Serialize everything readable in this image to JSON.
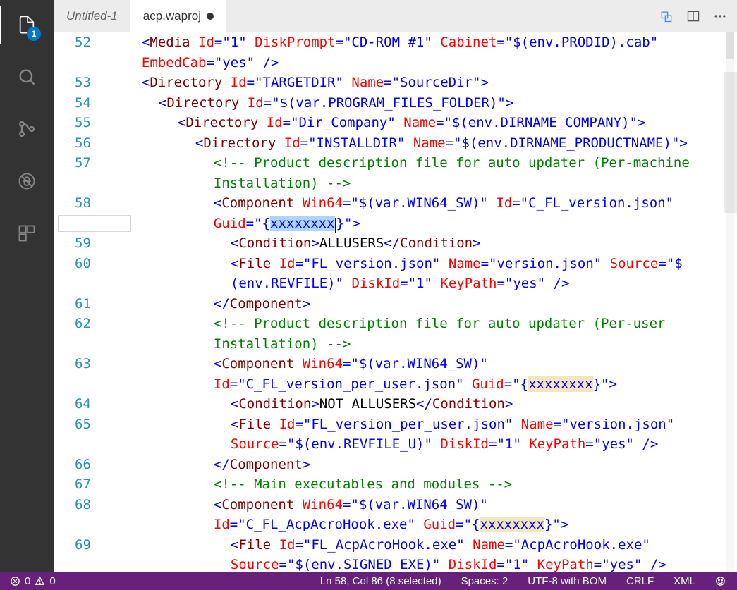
{
  "activityBar": {
    "explorerBadge": "1"
  },
  "tabs": {
    "tab0Label": "Untitled-1",
    "tab1Label": "acp.waproj"
  },
  "status": {
    "errors": "0",
    "warnings": "0",
    "cursorPos": "Ln 58, Col 86 (8 selected)",
    "indentation": "Spaces: 2",
    "encoding": "UTF-8 with BOM",
    "eol": "CRLF",
    "language": "XML"
  },
  "gutter": {
    "l52": "52",
    "l53": "53",
    "l54": "54",
    "l55": "55",
    "l56": "56",
    "l57": "57",
    "l58": "58",
    "l59": "59",
    "l60": "60",
    "l61": "61",
    "l62": "62",
    "l63": "63",
    "l64": "64",
    "l65": "65",
    "l66": "66",
    "l67": "67",
    "l68": "68",
    "l69": "69"
  },
  "code": {
    "l52": {
      "ob": "<",
      "tag": "Media",
      "sp": " ",
      "a1": "Id",
      "eq": "=",
      "v1": "\"1\"",
      "sp2": " ",
      "a2": "DiskPrompt",
      "v2": "\"CD-ROM #1\"",
      "sp3": " ",
      "a3": "Cabinet",
      "v3": "\"$(env.PRODID).cab\""
    },
    "l52b": {
      "a4": "EmbedCab",
      "eq": "=",
      "v4": "\"yes\"",
      "cl": " />"
    },
    "l53": {
      "ob": "<",
      "tag": "Directory",
      "sp": " ",
      "a1": "Id",
      "eq": "=",
      "v1": "\"TARGETDIR\"",
      "sp2": " ",
      "a2": "Name",
      "v2": "\"SourceDir\"",
      "cl": ">"
    },
    "l54": {
      "ob": "<",
      "tag": "Directory",
      "sp": " ",
      "a1": "Id",
      "eq": "=",
      "v1": "\"$(var.PROGRAM_FILES_FOLDER)\"",
      "cl": ">"
    },
    "l55": {
      "ob": "<",
      "tag": "Directory",
      "sp": " ",
      "a1": "Id",
      "eq": "=",
      "v1": "\"Dir_Company\"",
      "sp2": " ",
      "a2": "Name",
      "v2": "\"$(env.DIRNAME_COMPANY)\"",
      "cl": ">"
    },
    "l56": {
      "ob": "<",
      "tag": "Directory",
      "sp": " ",
      "a1": "Id",
      "eq": "=",
      "v1": "\"INSTALLDIR\"",
      "sp2": " ",
      "a2": "Name",
      "v2": "\"$(env.DIRNAME_PRODUCTNAME)\"",
      "cl": ">"
    },
    "l57": {
      "cm1": "<!-- ",
      "cmTxt": "Product description file for auto updater (Per-machine"
    },
    "l57b": {
      "cmTxt": "Installation)",
      "cm2": " -->"
    },
    "l58": {
      "ob": "<",
      "tag": "Component",
      "sp": " ",
      "a1": "Win64",
      "eq": "=",
      "v1": "\"$(var.WIN64_SW)\"",
      "sp2": " ",
      "a2": "Id",
      "v2": "\"C_FL_version.json\""
    },
    "l58b": {
      "a3": "Guid",
      "eq": "=",
      "v3o": "\"{",
      "sel": "xxxxxxxx",
      "v3c": "}\"",
      "cl": ">"
    },
    "l59": {
      "ob": "<",
      "tag": "Condition",
      "cl": ">",
      "txt": "ALLUSERS",
      "co": "</",
      "tag2": "Condition",
      "cc": ">"
    },
    "l60": {
      "ob": "<",
      "tag": "File",
      "sp": " ",
      "a1": "Id",
      "eq": "=",
      "v1": "\"FL_version.json\"",
      "sp2": " ",
      "a2": "Name",
      "v2": "\"version.json\"",
      "sp3": " ",
      "a3": "Source",
      "v3": "\"$"
    },
    "l60b": {
      "v3": "(env.REVFILE)\"",
      "sp": " ",
      "a4": "DiskId",
      "eq": "=",
      "v4": "\"1\"",
      "sp2": " ",
      "a5": "KeyPath",
      "v5": "\"yes\"",
      "cl": " />"
    },
    "l61": {
      "co": "</",
      "tag": "Component",
      "cc": ">"
    },
    "l62": {
      "cm1": "<!-- ",
      "cmTxt": "Product description file for auto updater (Per-user"
    },
    "l62b": {
      "cmTxt": "Installation)",
      "cm2": " -->"
    },
    "l63": {
      "ob": "<",
      "tag": "Component",
      "sp": " ",
      "a1": "Win64",
      "eq": "=",
      "v1": "\"$(var.WIN64_SW)\""
    },
    "l63b": {
      "a2": "Id",
      "eq": "=",
      "v2": "\"C_FL_version_per_user.json\"",
      "sp": " ",
      "a3": "Guid",
      "v3o": "\"{",
      "hl": "xxxxxxxx",
      "v3c": "}\"",
      "cl": ">"
    },
    "l64": {
      "ob": "<",
      "tag": "Condition",
      "cl": ">",
      "txt": "NOT ALLUSERS",
      "co": "</",
      "tag2": "Condition",
      "cc": ">"
    },
    "l65": {
      "ob": "<",
      "tag": "File",
      "sp": " ",
      "a1": "Id",
      "eq": "=",
      "v1": "\"FL_version_per_user.json\"",
      "sp2": " ",
      "a2": "Name",
      "v2": "\"version.json\""
    },
    "l65b": {
      "a3": "Source",
      "eq": "=",
      "v3": "\"$(env.REVFILE_U)\"",
      "sp": " ",
      "a4": "DiskId",
      "v4": "\"1\"",
      "sp2": " ",
      "a5": "KeyPath",
      "v5": "\"yes\"",
      "cl": " />"
    },
    "l66": {
      "co": "</",
      "tag": "Component",
      "cc": ">"
    },
    "l67": {
      "cm1": "<!-- ",
      "cmTxt": "Main executables and modules",
      "cm2": " -->"
    },
    "l68": {
      "ob": "<",
      "tag": "Component",
      "sp": " ",
      "a1": "Win64",
      "eq": "=",
      "v1": "\"$(var.WIN64_SW)\""
    },
    "l68b": {
      "a2": "Id",
      "eq": "=",
      "v2": "\"C_FL_AcpAcroHook.exe\"",
      "sp": " ",
      "a3": "Guid",
      "v3o": "\"{",
      "hl": "xxxxxxxx",
      "v3c": "}\"",
      "cl": ">"
    },
    "l69": {
      "ob": "<",
      "tag": "File",
      "sp": " ",
      "a1": "Id",
      "eq": "=",
      "v1": "\"FL_AcpAcroHook.exe\"",
      "sp2": " ",
      "a2": "Name",
      "v2": "\"AcpAcroHook.exe\""
    },
    "l69b": {
      "a3": "Source",
      "eq": "=",
      "v3": "\"$(env.SIGNED_EXE)\"",
      "sp": " ",
      "a4": "DiskId",
      "v4": "\"1\"",
      "sp2": " ",
      "a5": "KeyPath",
      "v5": "\"yes\"",
      "cl": " />"
    }
  }
}
